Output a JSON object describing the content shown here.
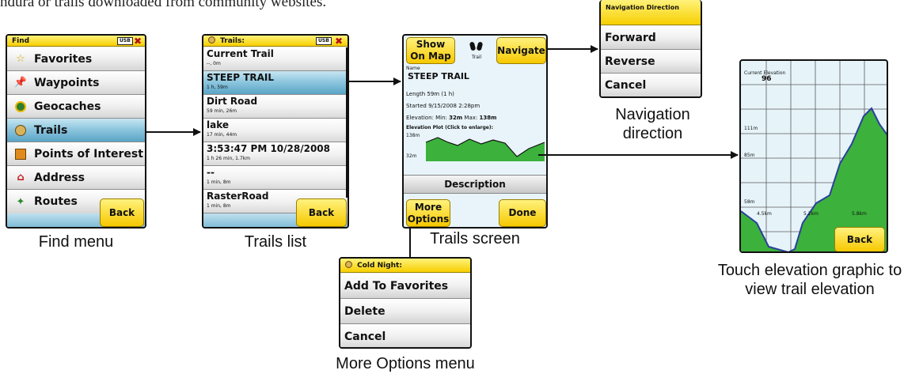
{
  "intro_text": "ndura or trails downloaded from community websites.",
  "find_menu": {
    "title": "Find",
    "usb": "USB",
    "items": [
      {
        "label": "Favorites",
        "icon": "star-icon"
      },
      {
        "label": "Waypoints",
        "icon": "pushpin-icon"
      },
      {
        "label": "Geocaches",
        "icon": "geocache-icon"
      },
      {
        "label": "Trails",
        "icon": "footprints-icon"
      },
      {
        "label": "Points of Interest",
        "icon": "poi-icon"
      },
      {
        "label": "Address",
        "icon": "house-icon"
      },
      {
        "label": "Routes",
        "icon": "routes-icon"
      }
    ],
    "back": "Back",
    "caption": "Find menu"
  },
  "trails_list": {
    "title": "Trails:",
    "usb": "USB",
    "items": [
      {
        "name": "Current Trail",
        "detail": "--, 0m"
      },
      {
        "name": "STEEP TRAIL",
        "detail": "1 h, 59m"
      },
      {
        "name": "Dirt Road",
        "detail": "59 min, 26m"
      },
      {
        "name": "lake",
        "detail": "17 min, 44m"
      },
      {
        "name": "3:53:47 PM 10/28/2008",
        "detail": "1 h 26 min, 1.7km"
      },
      {
        "name": "--",
        "detail": "1 min, 8m"
      },
      {
        "name": "RasterRoad",
        "detail": "1 min, 8m"
      }
    ],
    "back": "Back",
    "caption": "Trails list"
  },
  "trail_screen": {
    "show_on_map": "Show On Map",
    "trail_icon_label": "Trail",
    "navigate": "Navigate",
    "name_label": "Name",
    "name": "STEEP TRAIL",
    "length": "Length 59m (1 h)",
    "started": "Started 9/15/2008 2:28pm",
    "elevation_prefix": "Elevation: Min:",
    "elevation_min": "32m",
    "elevation_mid": "Max:",
    "elevation_max": "138m",
    "plot_label": "Elevation Plot (Click to enlarge):",
    "plot_top": "138m",
    "plot_bottom": "32m",
    "description": "Description",
    "more_options": "More Options",
    "done": "Done",
    "caption": "Trails screen"
  },
  "navigation_direction": {
    "title": "Navigation Direction",
    "items": [
      "Forward",
      "Reverse",
      "Cancel"
    ],
    "caption": "Navigation direction"
  },
  "more_options_menu": {
    "title": "Cold Night:",
    "items": [
      "Add To Favorites",
      "Delete",
      "Cancel"
    ],
    "caption": "More Options menu"
  },
  "elevation_screen": {
    "title": "Current Elevation",
    "current": "96",
    "y_labels": [
      "111m",
      "85m",
      "58m"
    ],
    "x_labels": [
      "4.5km",
      "5.2km",
      "5.8km"
    ],
    "back": "Back",
    "caption": "Touch elevation graphic to view trail elevation"
  },
  "colors": {
    "yellow": "#f7cf00",
    "selection_blue": "#5aa4c6",
    "terrain_green": "#3cb13c",
    "sky": "#e6f4fa"
  }
}
